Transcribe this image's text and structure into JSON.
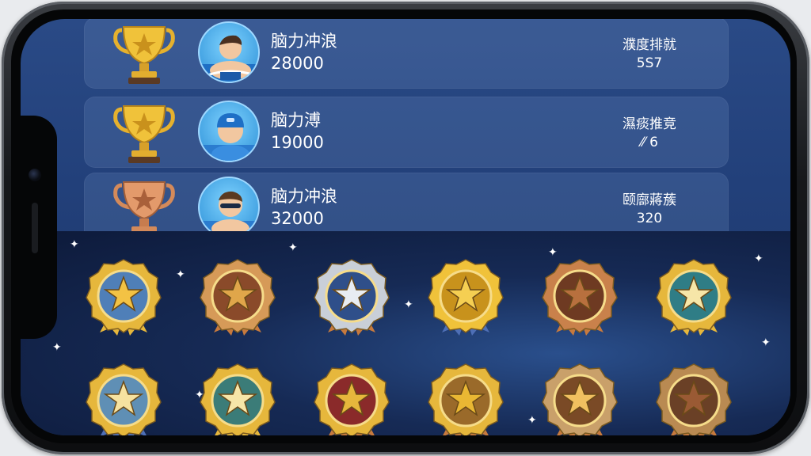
{
  "leaderboard": [
    {
      "trophy": "gold",
      "name": "脑力冲浪",
      "score": "28000",
      "rank_label": "濮度排就",
      "rank_value": "5S7",
      "avatar": "surfer-icon"
    },
    {
      "trophy": "gold",
      "name": "脑力溥",
      "score": "19000",
      "rank_label": "濕痰推竞",
      "rank_value": "⁄⁄ 6",
      "avatar": "cap-icon"
    },
    {
      "trophy": "bronze",
      "name": "脑力冲浪",
      "score": "32000",
      "rank_label": "颐廍蔣蔟",
      "rank_value": "320",
      "avatar": "goggles-icon"
    }
  ],
  "badges_row1": [
    "blue-gold",
    "bronze",
    "silver-blue",
    "gold",
    "bronze-dark",
    "teal-gold"
  ],
  "badges_row2": [
    "silver-gold",
    "gold-teal",
    "red-gold",
    "gold-bronze",
    "bronze-plain",
    "bronze-brown"
  ],
  "colors": {
    "gold": "#e9b733",
    "bronze": "#c9814b",
    "silver": "#c9cfd8",
    "panel": "#22407a",
    "space": "#0d1a3a"
  }
}
